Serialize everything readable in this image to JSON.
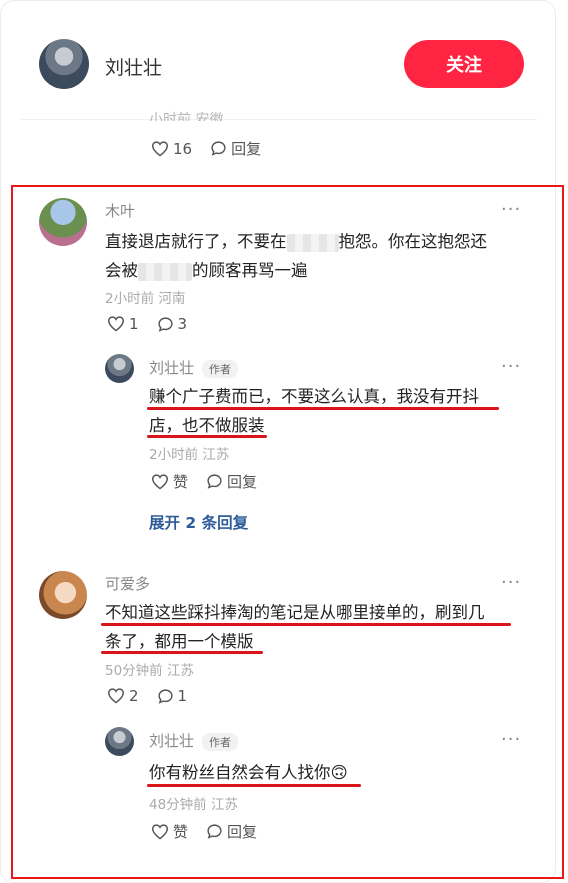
{
  "header": {
    "username": "刘壮壮",
    "follow_label": "关注"
  },
  "top_partial": {
    "cut_text": "小时前 安徽",
    "like_count": "16",
    "reply_label": "回复"
  },
  "comments": [
    {
      "username": "木叶",
      "text_a": "直接退店就行了，不要在",
      "text_b": "抱怨。你在这抱怨还",
      "text_c": "会被",
      "text_d": "的顾客再骂一遍",
      "meta": "2小时前 河南",
      "like_count": "1",
      "reply_count": "3",
      "reply": {
        "username": "刘壮壮",
        "badge": "作者",
        "line1": "赚个广子费而已，不要这么认真，我没有开抖",
        "line2": "店，也不做服装",
        "meta": "2小时前 江苏",
        "like_label": "赞",
        "reply_label": "回复"
      },
      "expand_label": "展开 2 条回复"
    },
    {
      "username": "可爱多",
      "line1": "不知道这些踩抖捧淘的笔记是从哪里接单的，刷到几",
      "line2": "条了，都用一个模版",
      "meta": "50分钟前 江苏",
      "like_count": "2",
      "reply_count": "1",
      "reply": {
        "username": "刘壮壮",
        "badge": "作者",
        "text": "你有粉丝自然会有人找你",
        "emoji": "🙃",
        "meta": "48分钟前 江苏",
        "like_label": "赞",
        "reply_label": "回复"
      }
    }
  ],
  "more_glyph": "···",
  "colors": {
    "accent": "#ff2442",
    "annotation_red": "#e81818",
    "link_blue": "#2e5c9a"
  },
  "icons": [
    "heart-icon",
    "comment-icon"
  ]
}
